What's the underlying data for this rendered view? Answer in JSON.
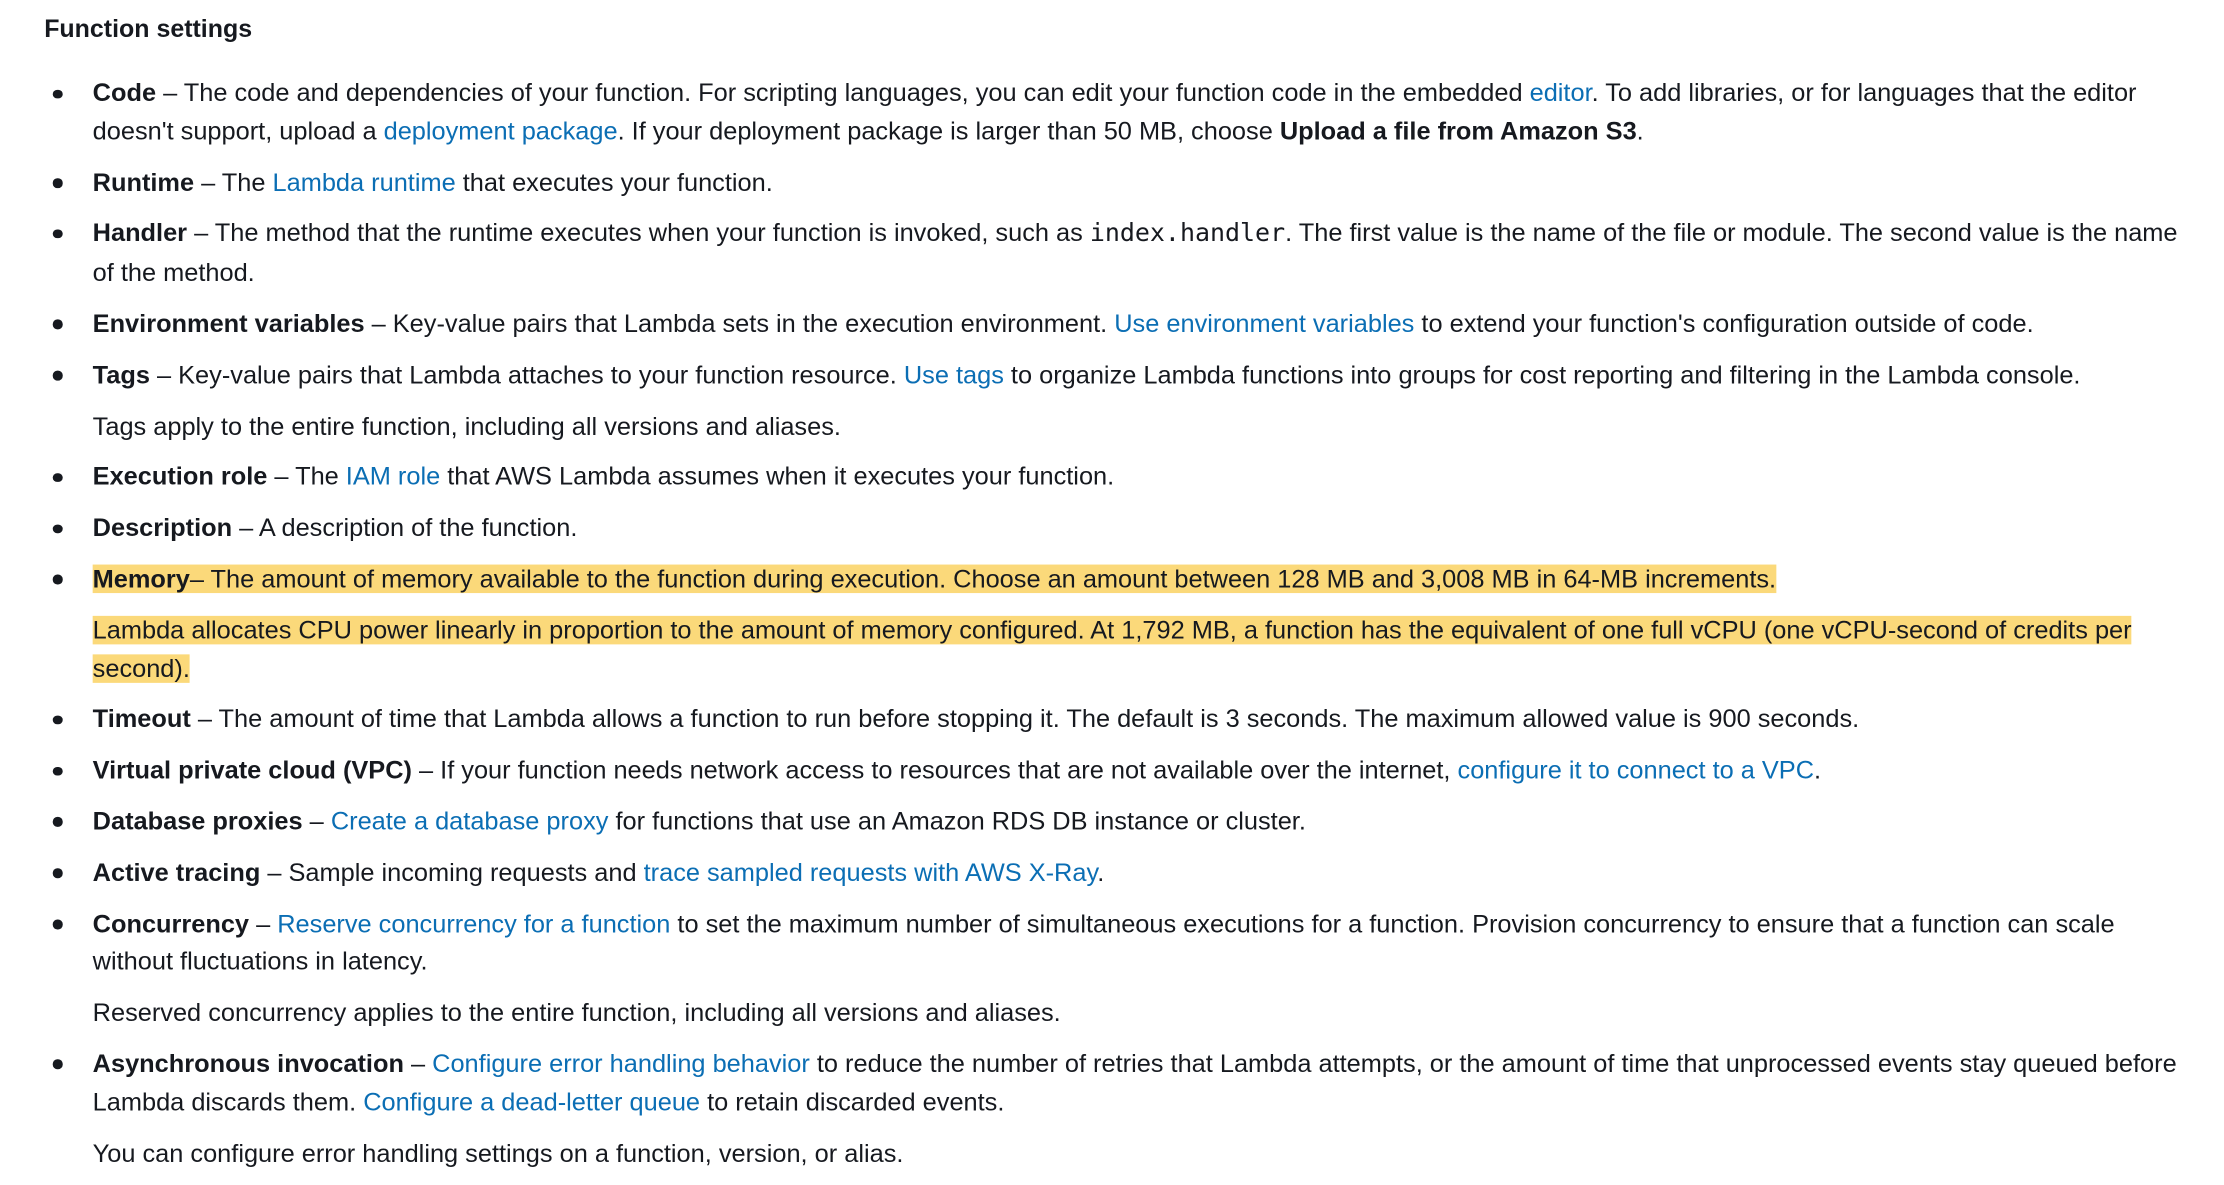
{
  "section_title": "Function settings",
  "items": {
    "code": {
      "term": "Code",
      "t1": " – The code and dependencies of your function. For scripting languages, you can edit your function code in the embedded ",
      "link1": "editor",
      "t2": ". To add libraries, or for languages that the editor doesn't support, upload a ",
      "link2": "deployment package",
      "t3": ". If your deployment package is larger than 50 MB, choose ",
      "bold": "Upload a file from Amazon S3",
      "t4": "."
    },
    "runtime": {
      "term": "Runtime",
      "t1": " – The ",
      "link1": "Lambda runtime",
      "t2": " that executes your function."
    },
    "handler": {
      "term": "Handler",
      "t1": " – The method that the runtime executes when your function is invoked, such as ",
      "code": "index.handler",
      "t2": ". The first value is the name of the file or module. The second value is the name of the method."
    },
    "environment_variables": {
      "term": "Environment variables",
      "t1": " – Key-value pairs that Lambda sets in the execution environment. ",
      "link1": "Use environment variables",
      "t2": " to extend your function's configuration outside of code."
    },
    "tags": {
      "term": "Tags",
      "t1": " – Key-value pairs that Lambda attaches to your function resource. ",
      "link1": "Use tags",
      "t2": " to organize Lambda functions into groups for cost reporting and filtering in the Lambda console.",
      "note": "Tags apply to the entire function, including all versions and aliases."
    },
    "execution_role": {
      "term": "Execution role",
      "t1": " – The ",
      "link1": "IAM role",
      "t2": " that AWS Lambda assumes when it executes your function."
    },
    "description": {
      "term": "Description",
      "t1": " – A description of the function."
    },
    "memory": {
      "term": "Memory",
      "t1": "– The amount of memory available to the function during execution. Choose an amount between 128 MB and 3,008 MB in 64-MB increments.",
      "note": "Lambda allocates CPU power linearly in proportion to the amount of memory configured. At 1,792 MB, a function has the equivalent of one full vCPU (one vCPU-second of credits per second).",
      "highlight_color": "#fbd97a"
    },
    "timeout": {
      "term": "Timeout",
      "t1": " – The amount of time that Lambda allows a function to run before stopping it. The default is 3 seconds. The maximum allowed value is 900 seconds."
    },
    "vpc": {
      "term": "Virtual private cloud (VPC)",
      "t1": " – If your function needs network access to resources that are not available over the internet, ",
      "link1": "configure it to connect to a VPC",
      "t2": "."
    },
    "database_proxies": {
      "term": "Database proxies",
      "t1": " – ",
      "link1": "Create a database proxy",
      "t2": " for functions that use an Amazon RDS DB instance or cluster."
    },
    "active_tracing": {
      "term": "Active tracing",
      "t1": " – Sample incoming requests and ",
      "link1": "trace sampled requests with AWS X-Ray",
      "t2": "."
    },
    "concurrency": {
      "term": "Concurrency",
      "t1": " – ",
      "link1": "Reserve concurrency for a function",
      "t2": " to set the maximum number of simultaneous executions for a function. Provision concurrency to ensure that a function can scale without fluctuations in latency.",
      "note": "Reserved concurrency applies to the entire function, including all versions and aliases."
    },
    "async_invocation": {
      "term": "Asynchronous invocation",
      "t1": " – ",
      "link1": "Configure error handling behavior",
      "t2": " to reduce the number of retries that Lambda attempts, or the amount of time that unprocessed events stay queued before Lambda discards them. ",
      "link2": "Configure a dead-letter queue",
      "t3": " to retain discarded events.",
      "note": "You can configure error handling settings on a function, version, or alias."
    }
  },
  "colors": {
    "text": "#16191f",
    "link": "#0b6eb4",
    "highlight": "#fbd97a"
  }
}
